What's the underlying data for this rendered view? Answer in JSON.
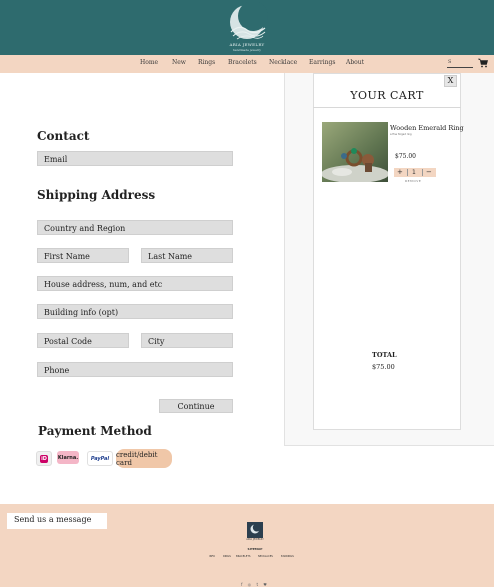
{
  "brand": {
    "name": "ARIA JEWELRY",
    "tagline": "handmade jewelry"
  },
  "nav": {
    "items": [
      "Home",
      "New",
      "Rings",
      "Bracelets",
      "Necklace",
      "Earrings",
      "About"
    ],
    "search_placeholder": "S"
  },
  "checkout": {
    "contact_heading": "Contact",
    "email_placeholder": "Email",
    "shipping_heading": "Shipping Address",
    "country_placeholder": "Country and Region",
    "first_name_placeholder": "First Name",
    "last_name_placeholder": "Last Name",
    "address_placeholder": "House address, num, and etc",
    "building_placeholder": "Building info (opt)",
    "postal_placeholder": "Postal Code",
    "city_placeholder": "City",
    "phone_placeholder": "Phone",
    "continue_label": "Continue",
    "payment_heading": "Payment Method",
    "payment_methods": {
      "ideal": "iD",
      "klarna": "Klarna.",
      "paypal": "PayPal",
      "card": "credit/debit card"
    }
  },
  "cart": {
    "title": "YOUR CART",
    "close_label": "X",
    "item_name": "Wooden Emerald Ring",
    "item_subtitle": "a fine forged ring",
    "item_price": "$75.00",
    "quantity": "1",
    "plus_label": "+",
    "minus_label": "−",
    "remove_label": "REMOVE",
    "total_label": "TOTAL",
    "total_value": "$75.00"
  },
  "footer": {
    "message_placeholder": "Send us a message",
    "logo_text": "ARIA JEWELRY",
    "sitemap_label": "SITEMAP",
    "links": [
      "INFO",
      "RINGS",
      "BRACELETS",
      "NECKLACES",
      "EARRINGS"
    ],
    "social": "f  ◎  t  ♥"
  },
  "colors": {
    "header_teal": "#2e6b6e",
    "peach": "#f3d6c2",
    "field_gray": "#dedede"
  }
}
